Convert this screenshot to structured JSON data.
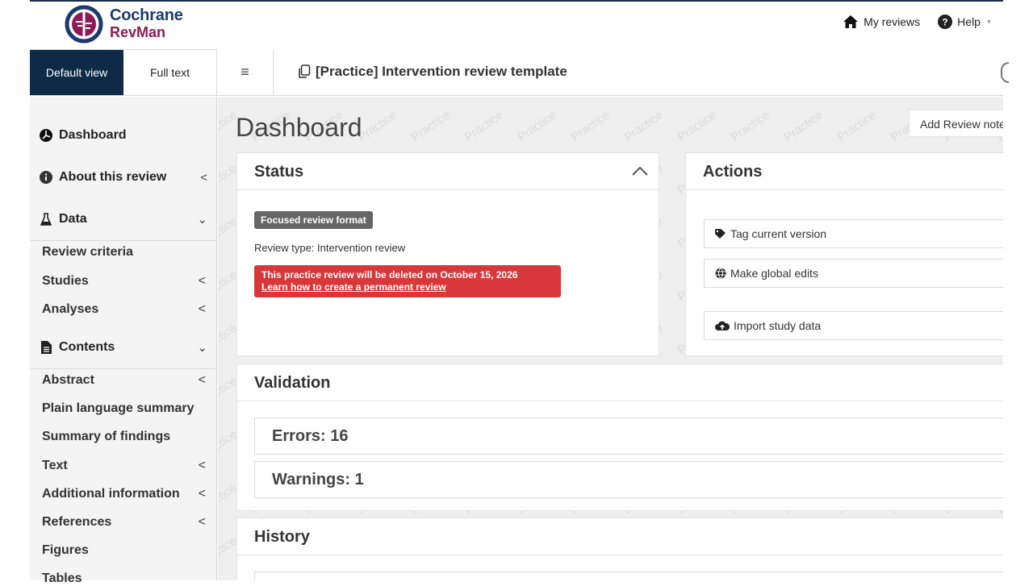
{
  "brand": {
    "line1": "Cochrane",
    "line2": "RevMan"
  },
  "topnav": {
    "my_reviews": "My reviews",
    "help": "Help"
  },
  "view_tabs": {
    "default": "Default view",
    "full": "Full text"
  },
  "toolbar": {
    "review_title": "[Practice] Intervention review template"
  },
  "watermark": "Practice",
  "sidebar": {
    "dashboard": "Dashboard",
    "about": "About this review",
    "data": "Data",
    "data_items": [
      "Review criteria",
      "Studies",
      "Analyses"
    ],
    "contents": "Contents",
    "contents_items": [
      "Abstract",
      "Plain language summary",
      "Summary of findings",
      "Text",
      "Additional information",
      "References",
      "Figures",
      "Tables"
    ]
  },
  "main": {
    "title": "Dashboard",
    "add_note": "Add Review note",
    "status": {
      "title": "Status",
      "badge": "Focused review format",
      "review_type": "Review type: Intervention review",
      "alert_line1": "This practice review will be deleted on October 15, 2026",
      "alert_link": "Learn how to create a permanent review"
    },
    "actions": {
      "title": "Actions",
      "tag": "Tag current version",
      "global": "Make global edits",
      "import": "Import study data"
    },
    "validation": {
      "title": "Validation",
      "errors": "Errors: 16",
      "warnings": "Warnings: 1"
    },
    "history": {
      "title": "History"
    }
  },
  "colors": {
    "navy": "#0e2a47",
    "alert": "#d9383a",
    "badge": "#666666",
    "brand_blue": "#1c3a6e",
    "brand_plum": "#8e1a55"
  }
}
